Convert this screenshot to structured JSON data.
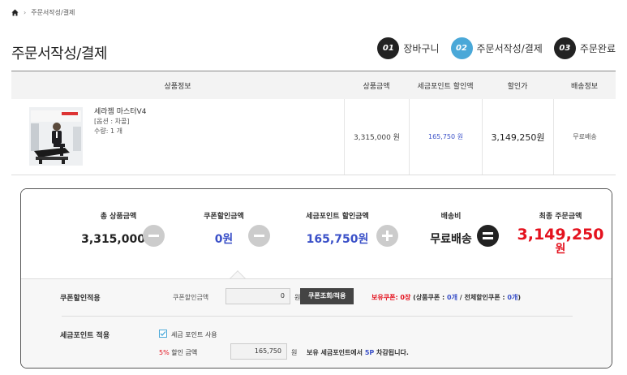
{
  "breadcrumb": {
    "current": "주문서작성/결제"
  },
  "page_title": "주문서작성/결제",
  "steps": [
    {
      "num": "01",
      "label": "장바구니",
      "active": false
    },
    {
      "num": "02",
      "label": "주문서작성/결제",
      "active": true
    },
    {
      "num": "03",
      "label": "주문완료",
      "active": false
    }
  ],
  "table": {
    "headers": [
      "상품정보",
      "상품금액",
      "세금포인트 할인액",
      "할인가",
      "배송정보"
    ],
    "rows": [
      {
        "name": "세라젬 마스터V4",
        "option": "[옵션 : 차콜]",
        "qty": "수량: 1 개",
        "price": "3,315,000 원",
        "tax_discount": "165,750 원",
        "sale_price": "3,149,250원",
        "shipping": "무료배송"
      }
    ]
  },
  "summary": {
    "total_label": "총 상품금액",
    "total_value": "3,315,000원",
    "coupon_label": "쿠폰할인금액",
    "coupon_value": "0원",
    "tax_label": "세금포인트 할인금액",
    "tax_value": "165,750원",
    "ship_label": "배송비",
    "ship_value": "무료배송",
    "final_label": "최종 주문금액",
    "final_value": "3,149,250",
    "final_unit": "원"
  },
  "coupon_section": {
    "title": "쿠폰할인적용",
    "field_label": "쿠폰할인금액",
    "field_value": "0",
    "unit": "원",
    "button": "쿠폰조회/적용",
    "owned_label": "보유쿠폰: 0장",
    "detail_prefix": "(상품쿠폰 : ",
    "product_count": "0개",
    "detail_mid": " / 전체할인쿠폰 : ",
    "all_count": "0개",
    "detail_suffix": ")"
  },
  "tax_section": {
    "title": "세금포인트 적용",
    "checkbox_label": "세금 포인트 사용",
    "rate": "5%",
    "discount_label": " 할인 금액",
    "field_value": "165,750",
    "unit": "원",
    "note_prefix": "보유 세금포인트에서 ",
    "note_points": "5P",
    "note_suffix": " 차감됩니다."
  },
  "colors": {
    "accent": "#4aa8d8",
    "blue": "#3a50c8",
    "red": "#e4121e"
  }
}
